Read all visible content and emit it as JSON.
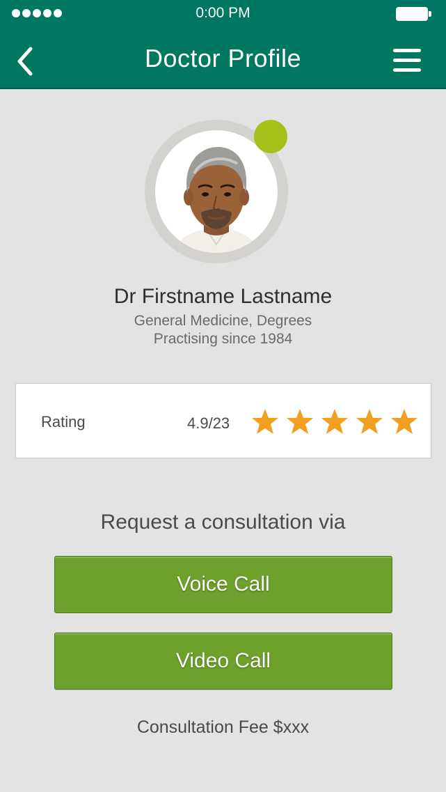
{
  "status_bar": {
    "time": "0:00 PM"
  },
  "header": {
    "title": "Doctor Profile",
    "back_icon": "chevron-left-icon",
    "menu_icon": "hamburger-menu-icon",
    "background_color": "#007760"
  },
  "doctor": {
    "name": "Dr Firstname Lastname",
    "specialty": "General Medicine, Degrees",
    "practising": "Practising since 1984",
    "online_status_color": "#a4c11a"
  },
  "rating": {
    "label": "Rating",
    "value": "4.9/23",
    "stars": 5,
    "star_color": "#f0a01e"
  },
  "consultation": {
    "prompt": "Request a consultation via",
    "voice_call_label": "Voice Call",
    "video_call_label": "Video Call",
    "button_color": "#6ea02c",
    "fee": "Consultation Fee $xxx"
  }
}
